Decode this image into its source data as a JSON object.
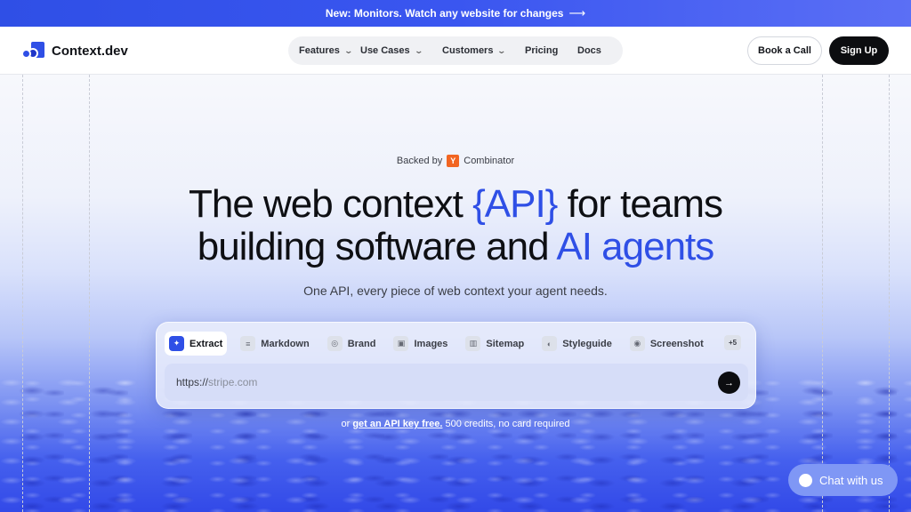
{
  "announcement": {
    "text": "New: Monitors. Watch any website for changes",
    "arrow": "⟶"
  },
  "brand": {
    "name": "Context.dev",
    "accent": "#2f4fe6"
  },
  "nav": {
    "items": [
      {
        "label": "Features",
        "icon": "chevron-down-icon"
      },
      {
        "label": "Use Cases",
        "icon": "chevron-down-icon"
      },
      {
        "label": "Customers",
        "icon": "chevron-down-icon"
      },
      {
        "label": "Pricing"
      },
      {
        "label": "Docs"
      }
    ]
  },
  "header": {
    "book_call": "Book a Call",
    "sign_up": "Sign Up"
  },
  "hero": {
    "backed_prefix": "Backed by",
    "yc_letter": "Y",
    "backed_suffix": "Combinator",
    "headline_1a": "The web context ",
    "headline_1b": "{API}",
    "headline_1c": " for teams",
    "headline_2a": "building software and ",
    "headline_2b": "AI agents",
    "subline": "One API, every piece of web context your agent needs."
  },
  "widget": {
    "tabs": [
      {
        "label": "Extract",
        "icon": "sparkle-icon"
      },
      {
        "label": "Markdown",
        "icon": "markdown-icon"
      },
      {
        "label": "Brand",
        "icon": "target-icon"
      },
      {
        "label": "Images",
        "icon": "image-icon"
      },
      {
        "label": "Sitemap",
        "icon": "map-icon"
      },
      {
        "label": "Styleguide",
        "icon": "palette-icon"
      },
      {
        "label": "Screenshot",
        "icon": "camera-icon"
      }
    ],
    "more": "+5",
    "url_prefix": "https://",
    "url_placeholder": "stripe.com"
  },
  "api_note": {
    "pre": "or ",
    "link": "get an API key free.",
    "post": " 500 credits, no card required"
  },
  "chat": {
    "label": "Chat with us"
  }
}
